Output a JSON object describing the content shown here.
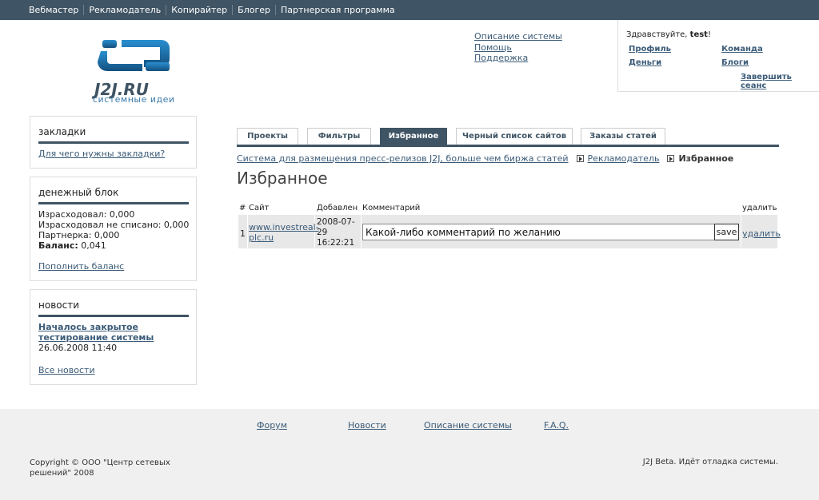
{
  "topnav": [
    "Вебмастер",
    "Рекламодатель",
    "Копирайтер",
    "Блогер",
    "Партнерская программа"
  ],
  "logo": {
    "brand": "J2J.RU",
    "tagline": "системные идеи"
  },
  "header_links": [
    "Описание системы",
    "Помощь",
    "Поддержка"
  ],
  "user": {
    "greeting": "Здравствуйте,",
    "name": "test",
    "exclam": "!",
    "links": {
      "profile": "Профиль",
      "team": "Команда",
      "money": "Деньги",
      "blogs": "Блоги",
      "logout": "Завершить сеанс"
    }
  },
  "sidebar": {
    "bookmarks": {
      "title": "закладки",
      "link": "Для чего нужны закладки?"
    },
    "money": {
      "title": "денежный блок",
      "spent": "Израсходовал: 0,000",
      "spent_pending": "Израсходовал не списано: 0,000",
      "affiliate": "Партнерка: 0,000",
      "balance_label": "Баланс:",
      "balance_value": " 0,041",
      "topup": "Пополнить баланс"
    },
    "news": {
      "title": "новости",
      "headline": "Началось закрытое тестирование системы",
      "date": "26.06.2008 11:40",
      "all": "Все новости"
    }
  },
  "tabs": [
    "Проекты",
    "Фильтры",
    "Избранное",
    "Черный список сайтов",
    "Заказы статей"
  ],
  "active_tab": "Избранное",
  "breadcrumb": {
    "root": "Система для размещения пресс-релизов J2J, больше чем биржа статей",
    "section": "Рекламодатель",
    "current": "Избранное"
  },
  "page_title": "Избранное",
  "table": {
    "headers": {
      "num": "#",
      "site": "Сайт",
      "added": "Добавлен",
      "comment": "Комментарий",
      "delete": "удалить"
    },
    "rows": [
      {
        "num": "1",
        "site": "www.investreal-plc.ru",
        "site_line1": "www.investreal-",
        "site_line2": "plc.ru",
        "date_line1": "2008-07-",
        "date_line2": "29",
        "date_line3": "16:22:21",
        "comment": "Какой-либо комментарий по желанию",
        "save": "save",
        "delete": "удалить"
      }
    ]
  },
  "footer": {
    "links": [
      "Форум",
      "Новости",
      "Описание системы",
      "F.A.Q."
    ],
    "copyright": "Copyright © ООО \"Центр сетевых решений\" 2008",
    "status": "J2J Beta. Идёт отладка системы."
  },
  "colors": {
    "dark": "#3f5464",
    "link": "#3b5b78",
    "accent": "#1f78b8"
  }
}
